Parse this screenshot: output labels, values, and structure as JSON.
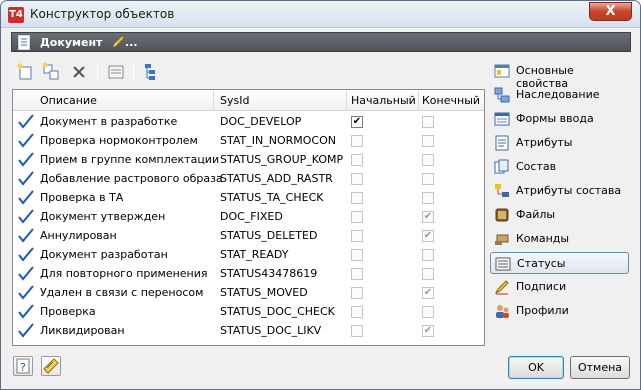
{
  "window": {
    "title": "Конструктор объектов",
    "app_icon_text": "T4",
    "close_symbol": "X"
  },
  "doc_header": {
    "title": "Документ",
    "ellipsis": "..."
  },
  "toolbar": {
    "icons": [
      "new-icon",
      "new-child-icon",
      "delete-icon",
      "properties-icon",
      "tree-icon"
    ]
  },
  "grid": {
    "headers": {
      "description": "Описание",
      "sysid": "SysId",
      "start": "Начальный",
      "end": "Конечный"
    },
    "rows": [
      {
        "description": "Документ в разработке",
        "sysid": "DOC_DEVELOP",
        "start": true,
        "end": false
      },
      {
        "description": "Проверка нормоконтролем",
        "sysid": "STAT_IN_NORMOCON",
        "start": false,
        "end": false
      },
      {
        "description": "Прием в группе комплектации",
        "sysid": "STATUS_GROUP_KOMP",
        "start": false,
        "end": false
      },
      {
        "description": "Добавление растрового образа",
        "sysid": "STATUS_ADD_RASTR",
        "start": false,
        "end": false
      },
      {
        "description": "Проверка в ТА",
        "sysid": "STATUS_TA_CHECK",
        "start": false,
        "end": false
      },
      {
        "description": "Документ утвержден",
        "sysid": "DOC_FIXED",
        "start": false,
        "end": true
      },
      {
        "description": "Аннулирован",
        "sysid": "STATUS_DELETED",
        "start": false,
        "end": true
      },
      {
        "description": "Документ разработан",
        "sysid": "STAT_READY",
        "start": false,
        "end": false
      },
      {
        "description": "Для повторного применения",
        "sysid": "STATUS43478619",
        "start": false,
        "end": false
      },
      {
        "description": "Удален в связи с переносом",
        "sysid": "STATUS_MOVED",
        "start": false,
        "end": true
      },
      {
        "description": "Проверка",
        "sysid": "STATUS_DOC_CHECK",
        "start": false,
        "end": false
      },
      {
        "description": "Ликвидирован",
        "sysid": "STATUS_DOC_LIKV",
        "start": false,
        "end": true
      }
    ]
  },
  "sidebar": {
    "items": [
      {
        "label": "Основные свойства",
        "icon": "properties-icon",
        "active": false
      },
      {
        "label": "Наследование",
        "icon": "inheritance-icon",
        "active": false
      },
      {
        "label": "Формы ввода",
        "icon": "form-icon",
        "active": false
      },
      {
        "label": "Атрибуты",
        "icon": "attributes-icon",
        "active": false
      },
      {
        "label": "Состав",
        "icon": "composition-icon",
        "active": false
      },
      {
        "label": "Атрибуты состава",
        "icon": "composition-attributes-icon",
        "active": false
      },
      {
        "label": "Файлы",
        "icon": "files-icon",
        "active": false
      },
      {
        "label": "Команды",
        "icon": "commands-icon",
        "active": false
      },
      {
        "label": "Статусы",
        "icon": "statuses-icon",
        "active": true
      },
      {
        "label": "Подписи",
        "icon": "signatures-icon",
        "active": false
      },
      {
        "label": "Профили",
        "icon": "profiles-icon",
        "active": false
      }
    ]
  },
  "footer": {
    "ok_label": "OK",
    "cancel_label": "Отмена",
    "help_icon": "help-icon",
    "notes_icon": "notes-icon"
  },
  "colors": {
    "header_bg": "#5a5e64",
    "check_blue": "#1d5bb6",
    "active_border": "#6e8aa7"
  }
}
